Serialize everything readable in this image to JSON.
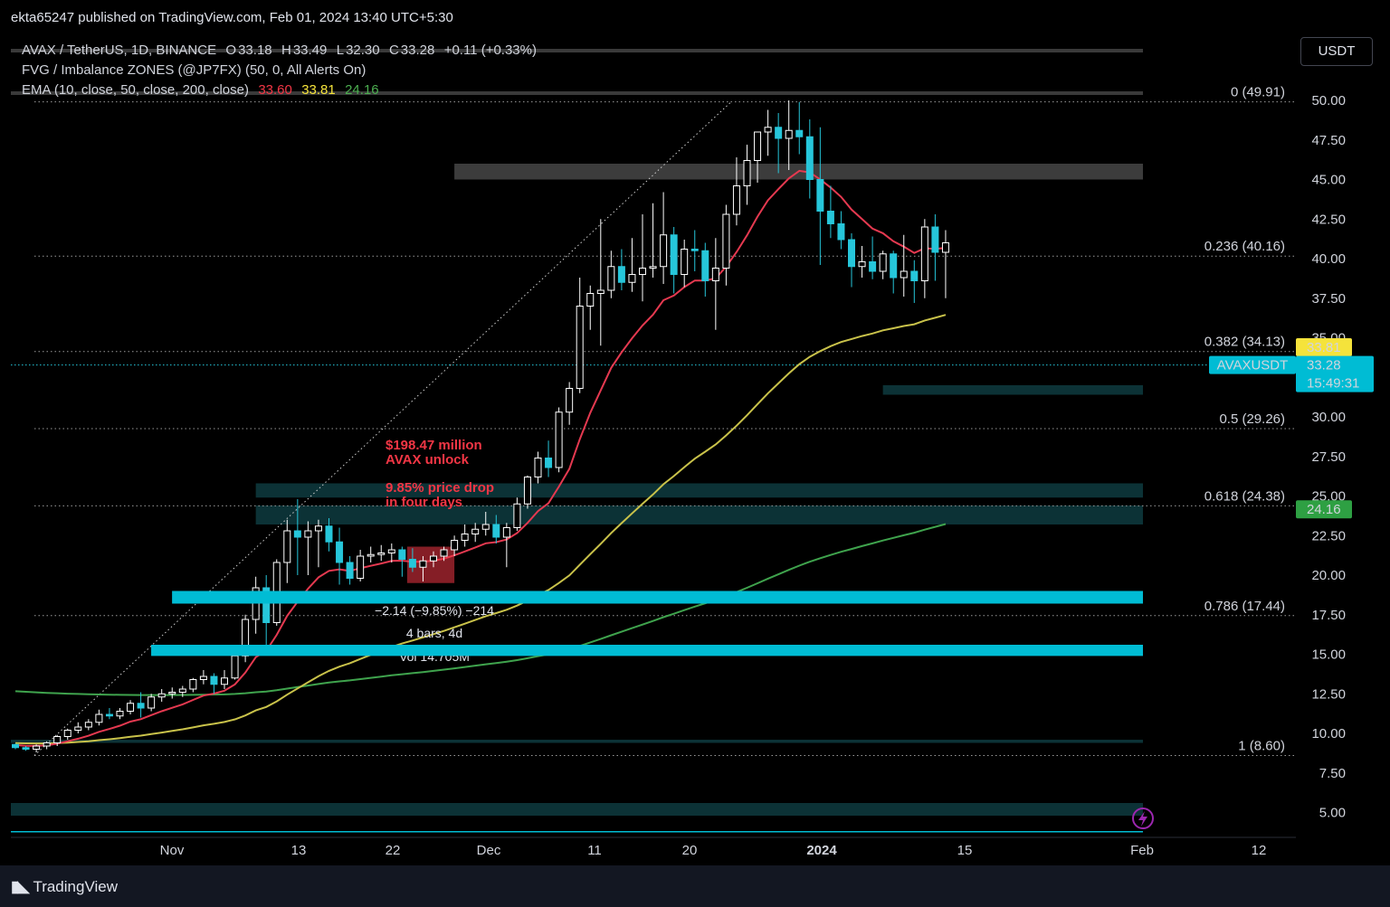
{
  "header": {
    "published": "ekta65247 published on TradingView.com, Feb 01, 2024 13:40 UTC+5:30"
  },
  "legend": {
    "symbol": "AVAX / TetherUS, 1D, BINANCE",
    "open_label": "O",
    "open": "33.18",
    "high_label": "H",
    "high": "33.49",
    "low_label": "L",
    "low": "32.30",
    "close_label": "C",
    "close": "33.28",
    "change": "+0.11 (+0.33%)",
    "indicator1": "FVG / Imbalance ZONES (@JP7FX) (50, 0, All Alerts On)",
    "indicator2": "EMA (10, close, 50, close, 200, close)",
    "ema10": "33.60",
    "ema50": "33.81",
    "ema200": "24.16"
  },
  "unit_button": "USDT",
  "branding": {
    "name": "TradingView"
  },
  "colors": {
    "up": "#ffffff",
    "down": "#26c6da",
    "ema10": "#e53950",
    "ema50": "#c9c24a",
    "ema200": "#3fa34d",
    "fvg_bright": "#00bcd4",
    "annotation": "#f23645"
  },
  "chart_data": {
    "type": "candlestick",
    "y_axis": {
      "min": 3.5,
      "max": 52,
      "ticks": [
        "50.00",
        "47.50",
        "45.00",
        "42.50",
        "40.00",
        "37.50",
        "35.00",
        "32.50",
        "30.00",
        "27.50",
        "25.00",
        "22.50",
        "20.00",
        "17.50",
        "15.00",
        "12.50",
        "10.00",
        "7.50",
        "5.00"
      ]
    },
    "x_axis": {
      "labels": [
        "Nov",
        "13",
        "22",
        "Dec",
        "11",
        "20",
        "2024",
        "15",
        "Feb",
        "12"
      ]
    },
    "fib_levels": [
      {
        "label": "0 (49.91)",
        "value": 49.91
      },
      {
        "label": "0.236 (40.16)",
        "value": 40.16
      },
      {
        "label": "0.382 (34.13)",
        "value": 34.13
      },
      {
        "label": "0.5 (29.26)",
        "value": 29.26
      },
      {
        "label": "0.618 (24.38)",
        "value": 24.38
      },
      {
        "label": "0.786 (17.44)",
        "value": 17.44
      },
      {
        "label": "1 (8.60)",
        "value": 8.6
      }
    ],
    "price_tags": [
      {
        "text": "33.81",
        "value": 34.4,
        "color": "#f5e33b",
        "text_color": "#000"
      },
      {
        "text": "33.60",
        "value": 33.0,
        "color": "#f23645",
        "text_color": "#fff"
      },
      {
        "text": "24.16",
        "value": 24.16,
        "color": "#2ea043",
        "text_color": "#fff"
      }
    ],
    "last_price": {
      "symbol": "AVAXUSDT",
      "price": "33.28",
      "countdown": "15:49:31",
      "value": 33.28
    },
    "zones": [
      {
        "from_index": 42,
        "y1": 46.0,
        "y2": 45.0,
        "kind": "gray"
      },
      {
        "from_index": 23,
        "y1": 25.8,
        "y2": 24.9,
        "kind": "teal"
      },
      {
        "from_index": 23,
        "y1": 24.4,
        "y2": 23.2,
        "kind": "teal"
      },
      {
        "from_index": 83,
        "y1": 32.0,
        "y2": 31.4,
        "kind": "teal"
      },
      {
        "from_index": 15,
        "y1": 19.0,
        "y2": 18.2,
        "kind": "bright"
      },
      {
        "from_index": 13,
        "y1": 15.6,
        "y2": 14.9,
        "kind": "bright"
      },
      {
        "from_index": -2,
        "y1": 5.6,
        "y2": 4.8,
        "kind": "teal"
      },
      {
        "from_index": -2,
        "y1": 9.6,
        "y2": 9.4,
        "kind": "teal"
      }
    ],
    "annotations": {
      "unlock_line1": "$198.47 million",
      "unlock_line2": "AVAX unlock",
      "drop_line1": "9.85% price drop",
      "drop_line2": "in four days",
      "measure_change": "−2.14 (−9.85%) −214",
      "measure_bars": "4 bars, 4d",
      "measure_vol": "Vol 14.705M"
    },
    "candles": [
      [
        9.3,
        9.35,
        9.0,
        9.1
      ],
      [
        9.1,
        9.2,
        8.9,
        9.0
      ],
      [
        9.0,
        9.3,
        8.8,
        9.2
      ],
      [
        9.2,
        9.5,
        9.0,
        9.4
      ],
      [
        9.4,
        9.9,
        9.2,
        9.8
      ],
      [
        9.8,
        10.3,
        9.6,
        10.2
      ],
      [
        10.2,
        10.7,
        10.0,
        10.4
      ],
      [
        10.4,
        10.9,
        10.2,
        10.7
      ],
      [
        10.7,
        11.5,
        10.5,
        11.2
      ],
      [
        11.2,
        11.6,
        10.9,
        11.1
      ],
      [
        11.1,
        11.6,
        10.9,
        11.4
      ],
      [
        11.4,
        12.1,
        11.2,
        11.9
      ],
      [
        11.9,
        12.6,
        11.0,
        11.6
      ],
      [
        11.6,
        12.5,
        11.4,
        12.3
      ],
      [
        12.3,
        12.8,
        12.0,
        12.5
      ],
      [
        12.5,
        12.9,
        12.2,
        12.6
      ],
      [
        12.6,
        13.0,
        12.3,
        12.8
      ],
      [
        12.8,
        13.5,
        12.6,
        13.4
      ],
      [
        13.4,
        14.0,
        13.1,
        13.6
      ],
      [
        13.6,
        13.8,
        12.5,
        13.1
      ],
      [
        13.1,
        14.0,
        12.8,
        13.5
      ],
      [
        13.5,
        15.0,
        13.4,
        14.9
      ],
      [
        14.9,
        17.5,
        14.5,
        17.2
      ],
      [
        17.2,
        19.9,
        16.3,
        19.2
      ],
      [
        19.2,
        20.0,
        15.6,
        17.0
      ],
      [
        17.0,
        21.0,
        16.8,
        20.8
      ],
      [
        20.8,
        23.5,
        19.5,
        22.8
      ],
      [
        22.8,
        24.8,
        20.0,
        22.4
      ],
      [
        22.4,
        23.4,
        20.0,
        22.8
      ],
      [
        22.8,
        23.5,
        20.5,
        23.1
      ],
      [
        23.1,
        23.6,
        21.5,
        22.1
      ],
      [
        22.1,
        23.0,
        19.4,
        20.8
      ],
      [
        20.8,
        21.2,
        19.4,
        19.8
      ],
      [
        19.8,
        21.6,
        19.6,
        21.2
      ],
      [
        21.2,
        21.8,
        20.8,
        21.3
      ],
      [
        21.3,
        21.9,
        20.9,
        21.4
      ],
      [
        21.4,
        22.0,
        20.8,
        21.6
      ],
      [
        21.6,
        21.8,
        19.9,
        21.0
      ],
      [
        21.0,
        21.7,
        20.2,
        20.5
      ],
      [
        20.5,
        21.2,
        19.6,
        20.9
      ],
      [
        20.9,
        21.5,
        20.5,
        21.2
      ],
      [
        21.2,
        21.8,
        20.9,
        21.6
      ],
      [
        21.6,
        22.5,
        21.2,
        22.2
      ],
      [
        22.2,
        23.2,
        21.8,
        22.6
      ],
      [
        22.6,
        23.3,
        22.1,
        22.9
      ],
      [
        22.9,
        24.0,
        22.5,
        23.2
      ],
      [
        23.2,
        23.8,
        22.0,
        22.4
      ],
      [
        22.4,
        23.3,
        20.5,
        23.0
      ],
      [
        23.0,
        24.9,
        22.8,
        24.5
      ],
      [
        24.5,
        26.3,
        24.2,
        26.2
      ],
      [
        26.2,
        27.8,
        25.8,
        27.4
      ],
      [
        27.4,
        28.5,
        26.2,
        26.8
      ],
      [
        26.8,
        30.6,
        26.5,
        30.3
      ],
      [
        30.3,
        32.2,
        29.5,
        31.8
      ],
      [
        31.8,
        38.8,
        31.5,
        37.0
      ],
      [
        37.0,
        38.3,
        35.5,
        37.8
      ],
      [
        37.8,
        42.5,
        34.5,
        38.0
      ],
      [
        38.0,
        40.5,
        37.5,
        39.5
      ],
      [
        39.5,
        40.6,
        38.0,
        38.5
      ],
      [
        38.5,
        41.3,
        37.9,
        39.0
      ],
      [
        39.0,
        42.8,
        37.3,
        39.4
      ],
      [
        39.4,
        43.5,
        38.8,
        39.5
      ],
      [
        39.5,
        44.2,
        38.4,
        41.5
      ],
      [
        41.5,
        42.0,
        37.8,
        39.0
      ],
      [
        39.0,
        41.2,
        38.2,
        40.6
      ],
      [
        40.6,
        41.8,
        39.2,
        40.5
      ],
      [
        40.5,
        41.0,
        37.6,
        38.6
      ],
      [
        38.6,
        41.3,
        35.5,
        39.4
      ],
      [
        39.4,
        43.4,
        38.3,
        42.8
      ],
      [
        42.8,
        46.4,
        42.1,
        44.6
      ],
      [
        44.6,
        47.2,
        43.4,
        46.2
      ],
      [
        46.2,
        47.6,
        44.8,
        48.0
      ],
      [
        48.0,
        49.4,
        46.5,
        48.3
      ],
      [
        48.3,
        49.2,
        45.4,
        47.6
      ],
      [
        47.6,
        50.0,
        45.6,
        48.1
      ],
      [
        48.1,
        49.9,
        46.6,
        47.7
      ],
      [
        47.7,
        48.8,
        43.8,
        45.0
      ],
      [
        45.0,
        48.3,
        39.6,
        43.0
      ],
      [
        43.0,
        44.6,
        41.3,
        42.2
      ],
      [
        42.2,
        43.0,
        40.6,
        41.2
      ],
      [
        41.2,
        41.6,
        38.2,
        39.5
      ],
      [
        39.5,
        40.8,
        38.8,
        39.8
      ],
      [
        39.8,
        41.4,
        38.7,
        39.2
      ],
      [
        39.2,
        40.5,
        38.7,
        40.3
      ],
      [
        40.3,
        40.5,
        37.8,
        38.8
      ],
      [
        38.8,
        41.5,
        37.6,
        39.2
      ],
      [
        39.2,
        39.9,
        37.2,
        38.6
      ],
      [
        38.6,
        42.5,
        37.5,
        42.0
      ],
      [
        42.0,
        42.8,
        38.6,
        40.4
      ],
      [
        40.4,
        41.8,
        37.5,
        41.0
      ]
    ]
  }
}
